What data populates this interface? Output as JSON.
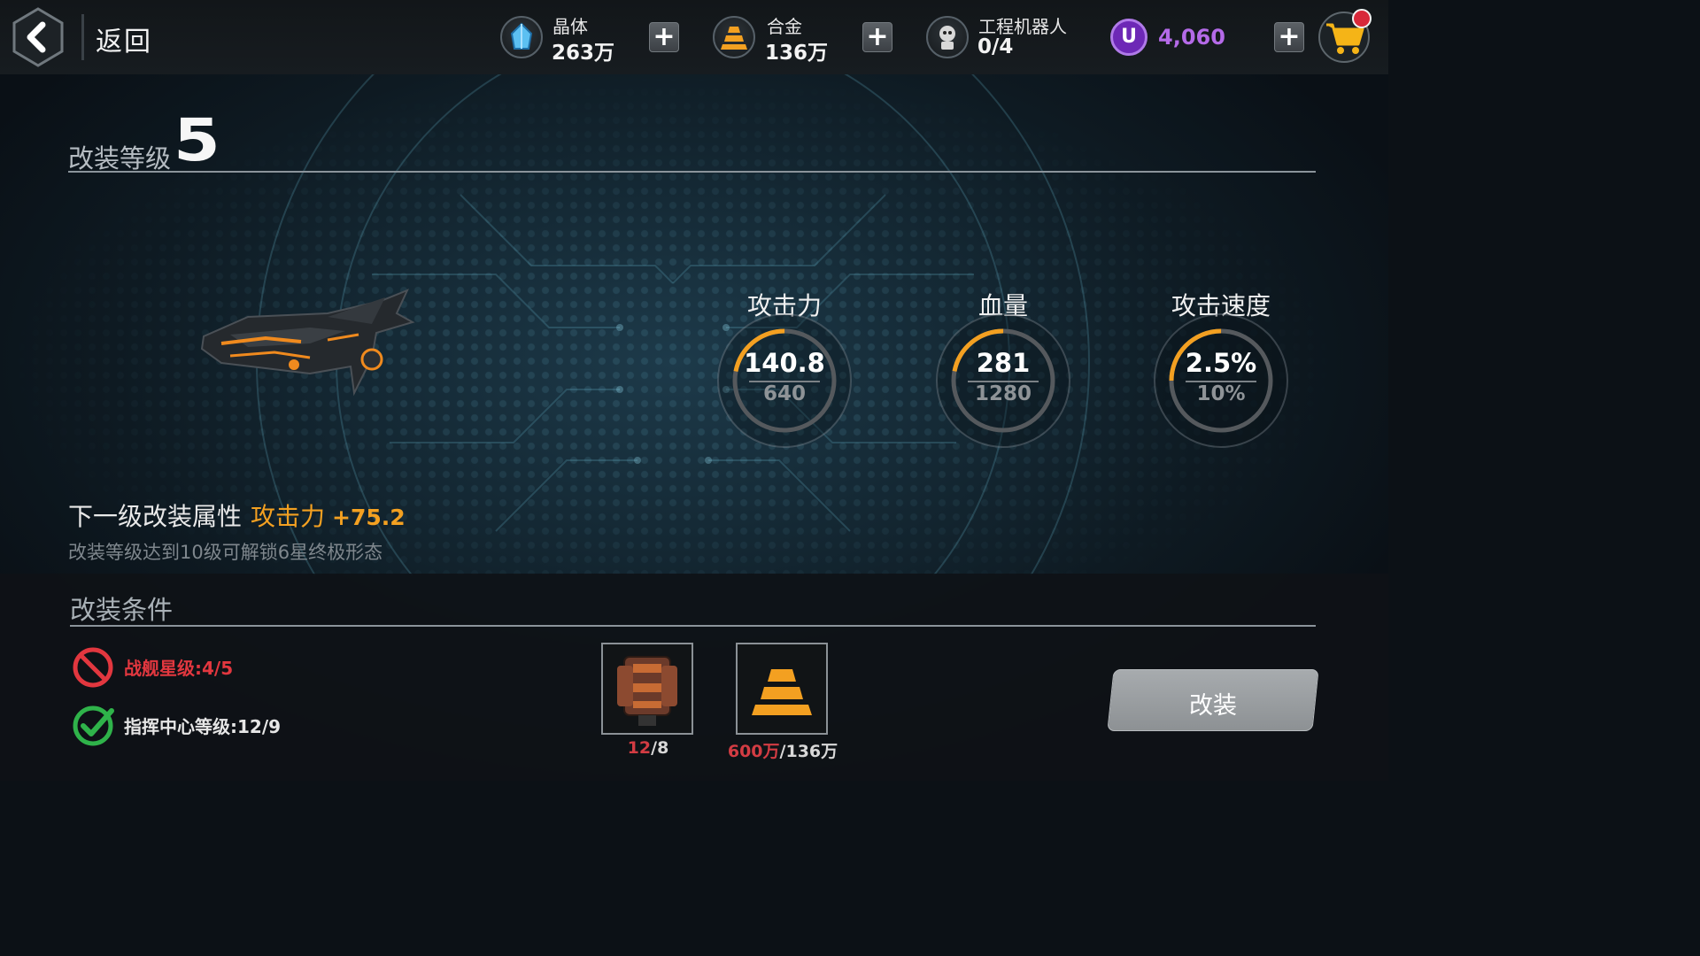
{
  "header": {
    "back_label": "返回",
    "resources": [
      {
        "name": "晶体",
        "value": "263万",
        "icon": "crystal-icon"
      },
      {
        "name": "合金",
        "value": "136万",
        "icon": "alloy-icon"
      },
      {
        "name": "工程机器人",
        "value": "0/4",
        "icon": "robot-icon"
      }
    ],
    "currency": {
      "icon_label": "U",
      "value": "4,060",
      "color": "#b46ae8"
    }
  },
  "modification": {
    "level_label": "改装等级",
    "level_value": "5"
  },
  "stats": [
    {
      "label": "攻击力",
      "current": "140.8",
      "max": "640"
    },
    {
      "label": "血量",
      "current": "281",
      "max": "1280"
    },
    {
      "label": "攻击速度",
      "current": "2.5%",
      "max": "10%"
    }
  ],
  "next_level": {
    "prefix": "下一级改装属性",
    "stat": "攻击力",
    "delta": "+75.2",
    "hint": "改装等级达到10级可解锁6星终极形态"
  },
  "conditions": {
    "title": "改装条件",
    "requirements": [
      {
        "text": "战舰星级:4/5",
        "met": false
      },
      {
        "text": "指挥中心等级:12/9",
        "met": true
      }
    ],
    "materials": [
      {
        "icon": "module-crate-icon",
        "have": "12",
        "need": "8"
      },
      {
        "icon": "alloy-icon",
        "have": "600万",
        "need": "136万"
      }
    ],
    "button_label": "改装"
  },
  "colors": {
    "accent_orange": "#f3a021",
    "fail_red": "#e2373f",
    "ok_green": "#2fb34a"
  }
}
